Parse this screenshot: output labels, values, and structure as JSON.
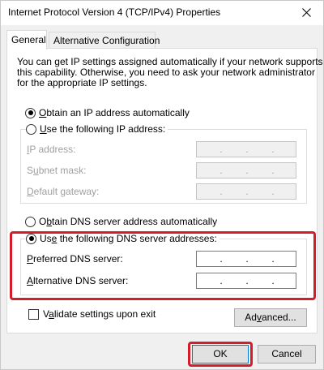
{
  "window": {
    "title": "Internet Protocol Version 4 (TCP/IPv4) Properties"
  },
  "tabs": [
    {
      "label": "General",
      "active": true
    },
    {
      "label": "Alternative Configuration",
      "active": false
    }
  ],
  "description": [
    "You can get IP settings assigned automatically if your network supports",
    "this capability. Otherwise, you need to ask your network administrator",
    "for the appropriate IP settings."
  ],
  "ip_section": {
    "auto": {
      "pre": "",
      "key": "O",
      "post": "btain an IP address automatically",
      "checked": true
    },
    "manual": {
      "pre": "",
      "key": "U",
      "post": "se the following IP address:",
      "checked": false
    },
    "fields": [
      {
        "pre": "",
        "key": "I",
        "post": "P address:",
        "value": ". . ."
      },
      {
        "pre": "S",
        "key": "u",
        "post": "bnet mask:",
        "value": ". . ."
      },
      {
        "pre": "",
        "key": "D",
        "post": "efault gateway:",
        "value": ". . ."
      }
    ]
  },
  "dns_section": {
    "auto": {
      "pre": "O",
      "key": "b",
      "post": "tain DNS server address automatically",
      "checked": false
    },
    "manual": {
      "pre": "Us",
      "key": "e",
      "post": " the following DNS server addresses:",
      "checked": true
    },
    "fields": [
      {
        "pre": "",
        "key": "P",
        "post": "referred DNS server:"
      },
      {
        "pre": "",
        "key": "A",
        "post": "lternative DNS server:"
      }
    ]
  },
  "validate": {
    "pre": "V",
    "key": "a",
    "post": "lidate settings upon exit",
    "checked": false
  },
  "buttons": {
    "advanced": {
      "pre": "Ad",
      "key": "v",
      "post": "anced..."
    },
    "ok": "OK",
    "cancel": "Cancel"
  },
  "colors": {
    "highlight": "#d41c2a",
    "default_button_border": "#0078d7"
  }
}
